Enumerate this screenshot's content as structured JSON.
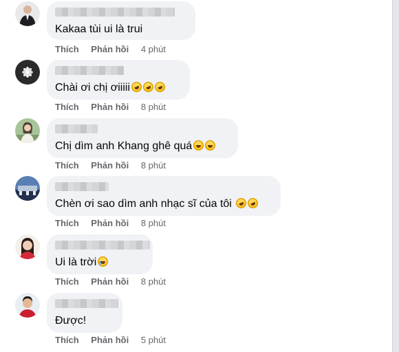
{
  "comments": [
    {
      "text": "Kakaa tùi ui là trui",
      "emojis": [],
      "like": "Thích",
      "reply": "Phản hồi",
      "time": "4 phút",
      "avatar_icon": "avatar-man-suit"
    },
    {
      "text": "Chài ơi chị ơiiiii",
      "emojis": [
        "rolling-on-floor-laughing",
        "rolling-on-floor-laughing",
        "rolling-on-floor-laughing"
      ],
      "like": "Thích",
      "reply": "Phản hồi",
      "time": "8 phút",
      "avatar_icon": "avatar-lotus-dark"
    },
    {
      "text": "Chị dìm anh Khang ghê quá",
      "emojis": [
        "grinning-sweat",
        "grinning-sweat"
      ],
      "like": "Thích",
      "reply": "Phản hồi",
      "time": "8 phút",
      "avatar_icon": "avatar-woman-outdoor"
    },
    {
      "text": "Chèn ơi sao dìm anh nhạc sĩ của tôi",
      "emojis": [
        "rolling-on-floor-laughing",
        "rolling-on-floor-laughing"
      ],
      "like": "Thích",
      "reply": "Phản hồi",
      "time": "8 phút",
      "avatar_icon": "avatar-building-blue"
    },
    {
      "text": "Ui là trời",
      "emojis": [
        "loudly-crying"
      ],
      "like": "Thích",
      "reply": "Phản hồi",
      "time": "8 phút",
      "avatar_icon": "avatar-woman-red"
    },
    {
      "text": "Được!",
      "emojis": [],
      "like": "Thích",
      "reply": "Phản hồi",
      "time": "5 phút",
      "avatar_icon": "avatar-man-red-shirt"
    }
  ]
}
